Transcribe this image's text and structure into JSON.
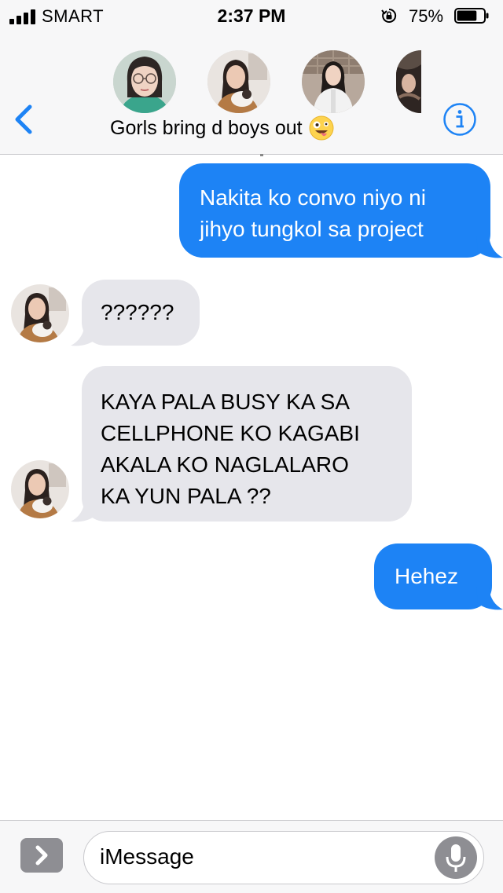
{
  "status_bar": {
    "carrier": "SMART",
    "time": "2:37 PM",
    "battery_percent": "75%",
    "battery_level": 0.75,
    "icons": [
      "signal-bars-icon",
      "rotation-lock-icon",
      "battery-icon"
    ]
  },
  "nav": {
    "group_name": "Gorls bring d boys out",
    "group_emoji": "zany-face-emoji",
    "back_icon": "chevron-left-icon",
    "info_icon": "info-icon",
    "accent_color": "#1d83f5"
  },
  "messages": [
    {
      "direction": "outgoing",
      "lines": [
        "Nakita ko convo niyo ni",
        "jihyo tungkol sa project"
      ]
    },
    {
      "direction": "incoming",
      "lines": [
        "??????"
      ]
    },
    {
      "direction": "incoming",
      "lines": [
        "KAYA PALA BUSY KA SA",
        "CELLPHONE KO KAGABI",
        "AKALA KO NAGLALARO",
        "KA YUN PALA ??"
      ]
    },
    {
      "direction": "outgoing",
      "lines": [
        "Hehez"
      ]
    }
  ],
  "input_bar": {
    "placeholder": "iMessage",
    "apps_icon": "chevron-right-icon",
    "mic_icon": "microphone-icon"
  },
  "colors": {
    "outgoing_bubble": "#1d83f5",
    "incoming_bubble": "#e6e6eb",
    "bar_background": "#f7f7f8"
  }
}
